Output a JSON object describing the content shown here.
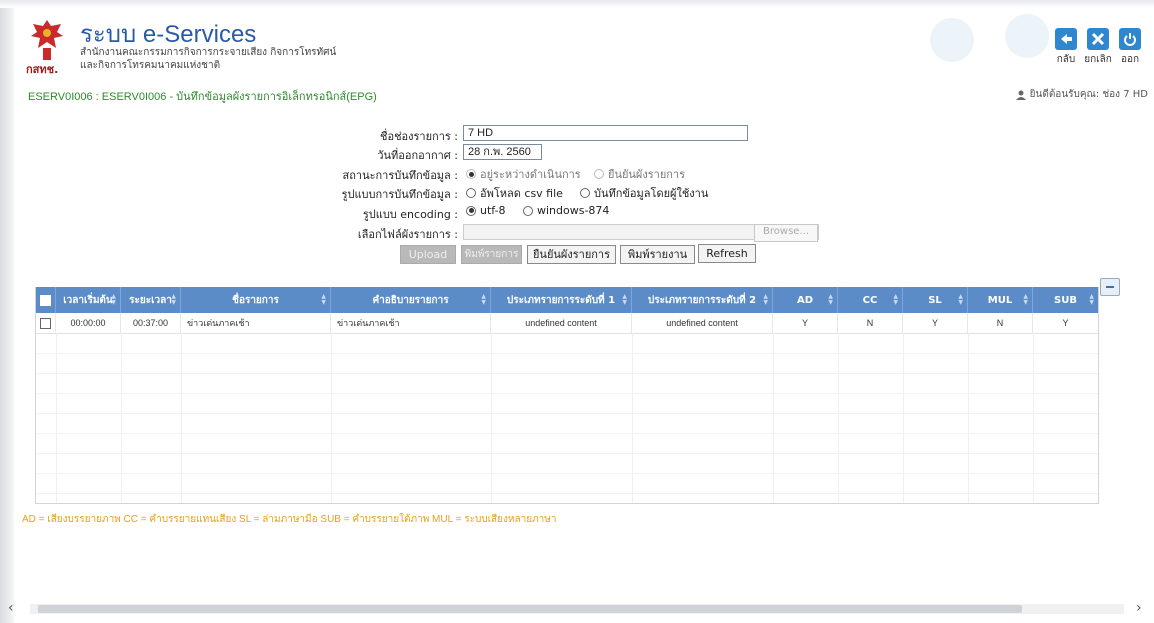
{
  "header": {
    "app_title": "ระบบ e-Services",
    "org_line1": "สำนักงานคณะกรรมการกิจการกระจายเสียง กิจการโทรทัศน์",
    "org_line2": "และกิจการโทรคมนาคมแห่งชาติ",
    "logo_text": "กสทช.",
    "screen_title": "ESERV0I006 : ESERV0I006 - บันทึกข้อมูลผังรายการอิเล็กทรอนิกส์(EPG)",
    "welcome": "ยินดีต้อนรับคุณ: ช่อง 7 HD",
    "buttons": {
      "back": "กลับ",
      "cancel": "ยกเลิก",
      "logout": "ออก"
    }
  },
  "form": {
    "channel_label": "ชื่อช่องรายการ :",
    "channel_value": "7 HD",
    "air_date_label": "วันที่ออกอากาศ :",
    "air_date_value": "28 ก.พ. 2560",
    "status_label": "สถานะการบันทึกข้อมูล :",
    "status_opt1": "อยู่ระหว่างดำเนินการ",
    "status_opt2": "ยืนยันผังรายการ",
    "mode_label": "รูปแบบการบันทึกข้อมูล :",
    "mode_opt1": "อัพโหลด csv file",
    "mode_opt2": "บันทึกข้อมูลโดยผู้ใช้งาน",
    "encoding_label": "รูปแบบ encoding :",
    "encoding_opt1": "utf-8",
    "encoding_opt2": "windows-874",
    "file_label": "เลือกไฟล์ผังรายการ :",
    "browse": "Browse...",
    "upload": "Upload",
    "print_programs": "พิมพ์รายการ",
    "confirm_programs": "ยืนยันผังรายการ",
    "print_report": "พิมพ์รายงาน",
    "refresh": "Refresh"
  },
  "table": {
    "headers": [
      "เวลาเริ่มต้น",
      "ระยะเวลา",
      "ชื่อรายการ",
      "คำอธิบายรายการ",
      "ประเภทรายการระดับที่ 1",
      "ประเภทรายการระดับที่ 2",
      "AD",
      "CC",
      "SL",
      "MUL",
      "SUB"
    ],
    "rows": [
      [
        "00:00:00",
        "00:37:00",
        "ข่าวเด่นภาคเช้า",
        "ข่าวเด่นภาคเช้า",
        "undefined content",
        "undefined content",
        "Y",
        "N",
        "Y",
        "N",
        "Y"
      ]
    ]
  },
  "legend": "AD = เสียงบรรยายภาพ CC = คำบรรยายแทนเสียง SL = ล่ามภาษามือ SUB = คำบรรยายใต้ภาพ MUL = ระบบเสียงหลายภาษา",
  "colors": {
    "accent": "#2f88cf",
    "header_row": "#5b8cc7",
    "title_green": "#2c8a2c",
    "legend_orange": "#e8a017"
  }
}
